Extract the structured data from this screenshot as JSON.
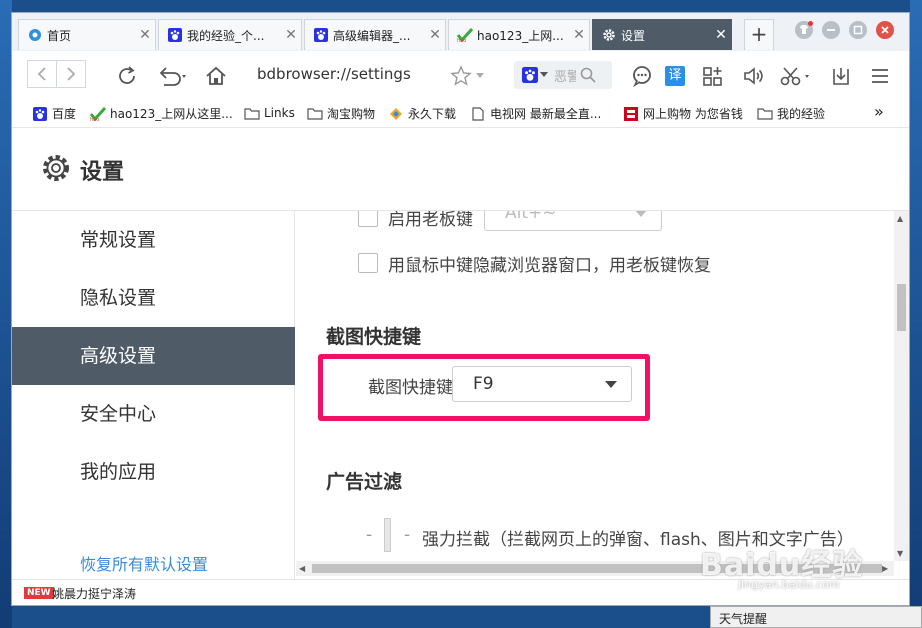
{
  "tabs": [
    {
      "label": "首页",
      "icon": "edge-style-blue-circle-icon"
    },
    {
      "label": "我的经验_个...",
      "icon": "baidu-paw-icon"
    },
    {
      "label": "高级编辑器_...",
      "icon": "baidu-paw-icon"
    },
    {
      "label": "hao123_上网...",
      "icon": "hao123-icon"
    },
    {
      "label": "设置",
      "icon": "gear-icon",
      "active": true
    }
  ],
  "new_tab_label": "+",
  "toolbar": {
    "url": "bdbrowser://settings",
    "search_placeholder": "恶警",
    "translate_label": "译"
  },
  "bookmarks": [
    {
      "label": "百度",
      "icon": "baidu-paw-icon"
    },
    {
      "label": "hao123_上网从这里...",
      "icon": "hao123-icon"
    },
    {
      "label": "Links",
      "icon": "folder-icon"
    },
    {
      "label": "淘宝购物",
      "icon": "folder-icon"
    },
    {
      "label": "永久下载",
      "icon": "colorful-logo-icon"
    },
    {
      "label": "电视网 最新最全直...",
      "icon": "page-icon"
    },
    {
      "label": "网上购物 为您省钱",
      "icon": "red-shop-icon"
    },
    {
      "label": "我的经验",
      "icon": "folder-icon"
    }
  ],
  "bookmarks_more": "»",
  "page": {
    "title": "设置"
  },
  "sidebar": {
    "items": [
      {
        "label": "常规设置"
      },
      {
        "label": "隐私设置"
      },
      {
        "label": "高级设置",
        "active": true
      },
      {
        "label": "安全中心"
      },
      {
        "label": "我的应用"
      }
    ],
    "restore_label": "恢复所有默认设置"
  },
  "content": {
    "boss_key_label": "启用老板键",
    "boss_key_value": "Alt+~",
    "middle_click_label": "用鼠标中键隐藏浏览器窗口，用老板键恢复",
    "screenshot_section_title": "截图快捷键",
    "screenshot_field_label": "截图快捷键",
    "screenshot_field_value": "F9",
    "adblock_section_title": "广告过滤",
    "adblock_option_label": "强力拦截（拦截网页上的弹窗、flash、图片和文字广告）",
    "dash": "-"
  },
  "statusbar": {
    "badge": "NEW",
    "news": "姚晨力挺宁泽涛"
  },
  "taskbar_tip": "天气提醒",
  "watermark": {
    "main": "Baidu经验",
    "sub": "jingyan.baidu.com"
  },
  "colors": {
    "accent_dark": "#4f5b66",
    "highlight_border": "#ee1166",
    "link": "#3a8bd8"
  }
}
